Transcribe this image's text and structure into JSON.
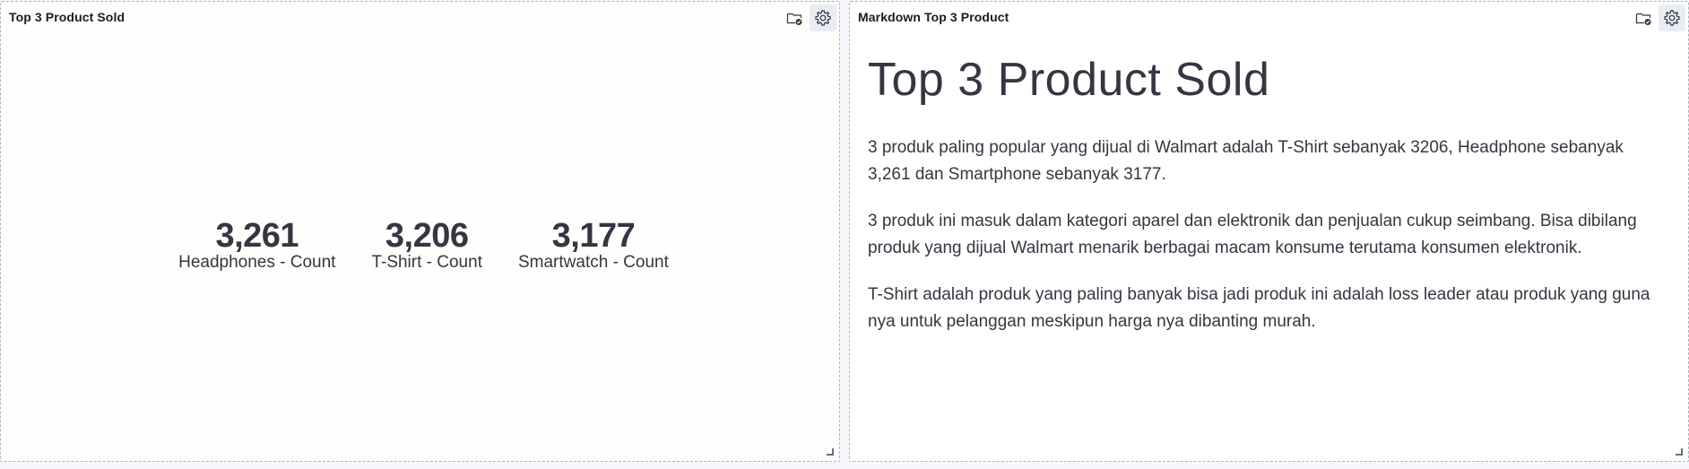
{
  "left_panel": {
    "title": "Top 3 Product Sold",
    "metrics": [
      {
        "value": "3,261",
        "label": "Headphones - Count"
      },
      {
        "value": "3,206",
        "label": "T-Shirt - Count"
      },
      {
        "value": "3,177",
        "label": "Smartwatch - Count"
      }
    ]
  },
  "right_panel": {
    "title": "Markdown Top 3 Product",
    "heading": "Top 3 Product Sold",
    "paragraphs": [
      "3 produk paling popular yang dijual di Walmart adalah T-Shirt sebanyak 3206, Headphone sebanyak 3,261 dan Smartphone sebanyak 3177.",
      "3 produk ini masuk dalam kategori aparel dan elektronik dan penjualan cukup seimbang. Bisa dibilang produk yang dijual Walmart menarik berbagai macam konsume terutama konsumen elektronik.",
      "T-Shirt adalah produk yang paling banyak bisa jadi produk ini adalah loss leader atau produk yang guna nya untuk pelanggan meskipun harga nya dibanting murah."
    ]
  },
  "icons": {
    "folder": "folder-check-icon",
    "settings": "gear-icon",
    "resize": "resize-handle-icon"
  },
  "colors": {
    "text": "#343741",
    "title": "#1a1c21",
    "border": "#a9b4c6",
    "active_button": "#e9edf3"
  }
}
